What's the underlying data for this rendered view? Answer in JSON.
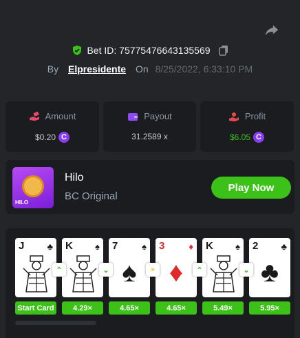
{
  "header": {
    "bet_id": "Bet ID: 75775476643135569",
    "by_label": "By",
    "username": "Elpresidente",
    "on_label": "On",
    "date": "8/25/2022, 6:33:10 PM"
  },
  "stats": [
    {
      "label": "Amount",
      "value": "$0.20",
      "icon": "money-hand-icon"
    },
    {
      "label": "Payout",
      "value": "31.2589 x",
      "icon": "wallet-icon"
    },
    {
      "label": "Profit",
      "value": "$6.05",
      "icon": "profit-hand-icon"
    }
  ],
  "coin_symbol": "C",
  "game": {
    "thumb_label": "HILO",
    "title": "Hilo",
    "subtitle": "BC Original",
    "play_label": "Play Now"
  },
  "cards": [
    {
      "rank": "J",
      "suit": "♣",
      "color": "black",
      "multiplier": "Start Card"
    },
    {
      "rank": "K",
      "suit": "♠",
      "color": "black",
      "multiplier": "4.29×"
    },
    {
      "rank": "7",
      "suit": "♠",
      "color": "black",
      "multiplier": "4.65×"
    },
    {
      "rank": "3",
      "suit": "♦",
      "color": "red",
      "multiplier": "4.65×"
    },
    {
      "rank": "K",
      "suit": "♠",
      "color": "black",
      "multiplier": "5.49×"
    },
    {
      "rank": "2",
      "suit": "♣",
      "color": "black",
      "multiplier": "5.95×"
    }
  ],
  "arrows": [
    {
      "symbol": "⌃",
      "color": "#3bc117",
      "icon": "chevron-up-icon"
    },
    {
      "symbol": "⌄",
      "color": "#3bc117",
      "icon": "chevron-down-icon"
    },
    {
      "symbol": "»",
      "color": "#f2c12e",
      "icon": "skip-icon"
    },
    {
      "symbol": "⌃",
      "color": "#3bc117",
      "icon": "chevron-up-icon"
    },
    {
      "symbol": "⌄",
      "color": "#3bc117",
      "icon": "chevron-down-icon"
    }
  ],
  "colors": {
    "accent": "#3bc117",
    "coin": "#8a3cf0",
    "background": "#232529",
    "panel": "#1a1c20"
  }
}
